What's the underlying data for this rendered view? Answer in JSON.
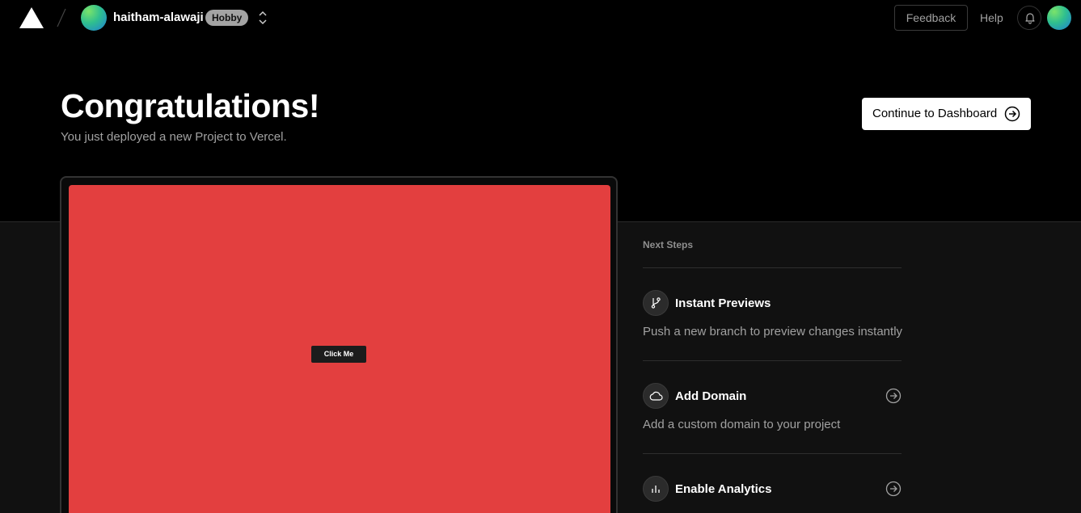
{
  "header": {
    "team_name": "haitham-alawaji",
    "plan_badge": "Hobby",
    "feedback_label": "Feedback",
    "help_label": "Help"
  },
  "hero": {
    "title": "Congratulations!",
    "subtitle": "You just deployed a new Project to Vercel.",
    "continue_label": "Continue to Dashboard"
  },
  "preview": {
    "button_label": "Click Me",
    "background_color": "#e33f3f"
  },
  "next_steps": {
    "title": "Next Steps",
    "items": [
      {
        "title": "Instant Previews",
        "description": "Push a new branch to preview changes instantly",
        "icon": "git-branch-icon"
      },
      {
        "title": "Add Domain",
        "description": "Add a custom domain to your project",
        "icon": "cloud-icon"
      },
      {
        "title": "Enable Analytics",
        "description": "",
        "icon": "bar-chart-icon"
      }
    ]
  },
  "colors": {
    "background": "#000000",
    "lower_background": "#111111",
    "muted_text": "#a1a1a1",
    "badge": "#a3a3a3"
  }
}
